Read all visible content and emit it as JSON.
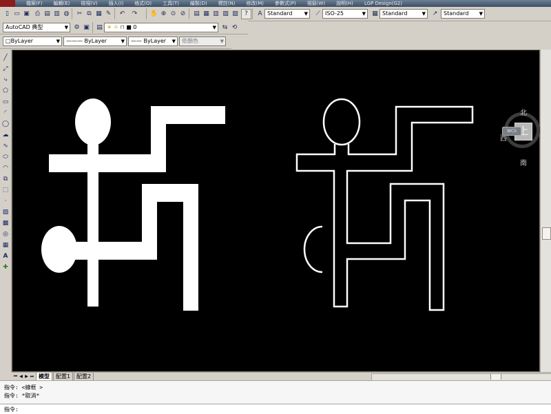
{
  "menu": {
    "items": [
      "檔案(F)",
      "編輯(E)",
      "檢視(V)",
      "插入(I)",
      "格式(O)",
      "工具(T)",
      "繪製(D)",
      "標註(N)",
      "修改(M)",
      "參數式(P)",
      "視窗(W)",
      "說明(H)",
      "LGP Design(G2)"
    ]
  },
  "toolbar": {
    "text_style": "Standard",
    "dim_style": "ISO-25",
    "table_style": "Standard",
    "multileader_style": "Standard",
    "workspace": "AutoCAD 典型",
    "layer": "0",
    "color": "ByLayer",
    "linetype": "ByLayer",
    "lineweight": "ByLayer",
    "plot_style": "依顏色"
  },
  "viewcube": {
    "face": "上",
    "north": "北",
    "south": "南",
    "west": "西",
    "east": "東",
    "wcs": "WCS"
  },
  "tabs": [
    "模型",
    "配置1",
    "配置2"
  ],
  "command": {
    "history": [
      "指令: <線框 >",
      "指令: *取消*"
    ],
    "prompt": "指令:"
  },
  "colors": {
    "canvas": "#000000",
    "geometry": "#ffffff"
  }
}
